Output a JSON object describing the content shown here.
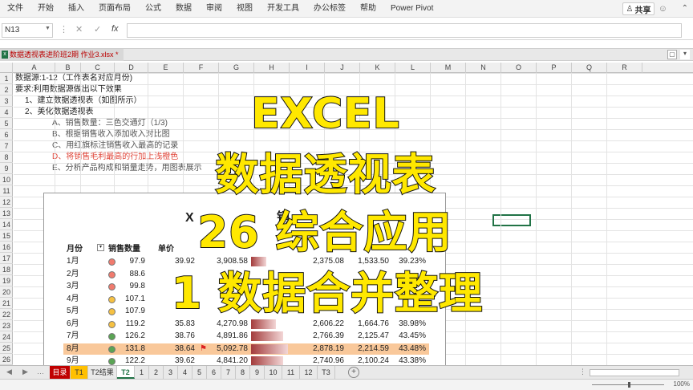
{
  "menu": [
    "文件",
    "开始",
    "插入",
    "页面布局",
    "公式",
    "数据",
    "审阅",
    "视图",
    "开发工具",
    "办公标签",
    "帮助",
    "Power Pivot"
  ],
  "share_label": "共享",
  "name_box": "N13",
  "workbook_tab": "数据透视表进阶班2期 作业3.xlsx *",
  "columns": [
    "A",
    "B",
    "C",
    "D",
    "E",
    "F",
    "G",
    "H",
    "I",
    "J",
    "K",
    "L",
    "M",
    "N",
    "O",
    "P",
    "Q",
    "R"
  ],
  "rows": [
    "1",
    "2",
    "3",
    "4",
    "5",
    "6",
    "7",
    "8",
    "9",
    "10",
    "11",
    "12",
    "13",
    "14",
    "15",
    "16",
    "17",
    "18",
    "19",
    "20",
    "21",
    "22",
    "23",
    "24",
    "25",
    "26"
  ],
  "sheet_text": {
    "r1": "数据源:1-12（工作表名对应月份)",
    "r2": "要求:利用数据源做出以下效果",
    "r3": "1、建立数据透视表（如图所示）",
    "r4": "2、美化数据透视表",
    "r5": "A、销售数量：三色交通灯（1/3)",
    "r6": "B、根据销售收入添加收入对比图",
    "r7": "C、用红旗标注销售收入最高的记录",
    "r8": "D、将销售毛利最高的行加上浅橙色",
    "r9": "E、分析产品构成和销量走势，用图表展示",
    "r8_color": "#e0463a"
  },
  "picture": {
    "title_prefix": "X",
    "title_partial": "销",
    "headers": [
      "月份",
      "销售数量",
      "单价"
    ],
    "rows": [
      {
        "month": "1月",
        "light": "red",
        "qty": "97.9",
        "price": "39.92",
        "rev": "3,908.58",
        "bar": 0.42,
        "cost": "2,375.08",
        "profit": "1,533.50",
        "margin": "39.23%",
        "flag": false,
        "hl": false
      },
      {
        "month": "2月",
        "light": "red",
        "qty": "88.6",
        "price": "",
        "rev": "",
        "bar": 0.0,
        "cost": "",
        "profit": "",
        "margin": "",
        "flag": false,
        "hl": false
      },
      {
        "month": "3月",
        "light": "red",
        "qty": "99.8",
        "price": "",
        "rev": "",
        "bar": 0.0,
        "cost": "",
        "profit": "",
        "margin": "",
        "flag": false,
        "hl": false
      },
      {
        "month": "4月",
        "light": "yellow",
        "qty": "107.1",
        "price": "",
        "rev": "",
        "bar": 0.0,
        "cost": "",
        "profit": "",
        "margin": "",
        "flag": false,
        "hl": false
      },
      {
        "month": "5月",
        "light": "yellow",
        "qty": "107.9",
        "price": "",
        "rev": "",
        "bar": 0.0,
        "cost": "",
        "profit": "",
        "margin": "",
        "flag": false,
        "hl": false
      },
      {
        "month": "6月",
        "light": "yellow",
        "qty": "119.2",
        "price": "35.83",
        "rev": "4,270.98",
        "bar": 0.68,
        "cost": "2,606.22",
        "profit": "1,664.76",
        "margin": "38.98%",
        "flag": false,
        "hl": false
      },
      {
        "month": "7月",
        "light": "green",
        "qty": "126.2",
        "price": "38.76",
        "rev": "4,891.86",
        "bar": 0.88,
        "cost": "2,766.39",
        "profit": "2,125.47",
        "margin": "43.45%",
        "flag": false,
        "hl": false
      },
      {
        "month": "8月",
        "light": "green",
        "qty": "131.8",
        "price": "38.64",
        "rev": "5,092.78",
        "bar": 1.0,
        "cost": "2,878.19",
        "profit": "2,214.59",
        "margin": "43.48%",
        "flag": true,
        "hl": true
      },
      {
        "month": "9月",
        "light": "green",
        "qty": "122.2",
        "price": "39.62",
        "rev": "4,841.20",
        "bar": 0.86,
        "cost": "2,740.96",
        "profit": "2,100.24",
        "margin": "43.38%",
        "flag": false,
        "hl": false
      }
    ]
  },
  "overlay": {
    "line1": "EXCEL",
    "line2": "数据透视表",
    "line3": "26 综合应用",
    "line4": "1 数据合并整理"
  },
  "sheet_tabs": [
    "目录",
    "T1",
    "T2结果",
    "T2",
    "1",
    "2",
    "3",
    "4",
    "5",
    "6",
    "7",
    "8",
    "9",
    "10",
    "11",
    "12",
    "T3"
  ],
  "active_tab": "T2",
  "zoom": "100%",
  "colors": {
    "accent": "#217346",
    "highlight": "#f9c89a",
    "red": "#e0463a",
    "tab_red": "#c00000",
    "tab_yellow": "#ffc000",
    "overlay_fill": "#ffe800"
  }
}
